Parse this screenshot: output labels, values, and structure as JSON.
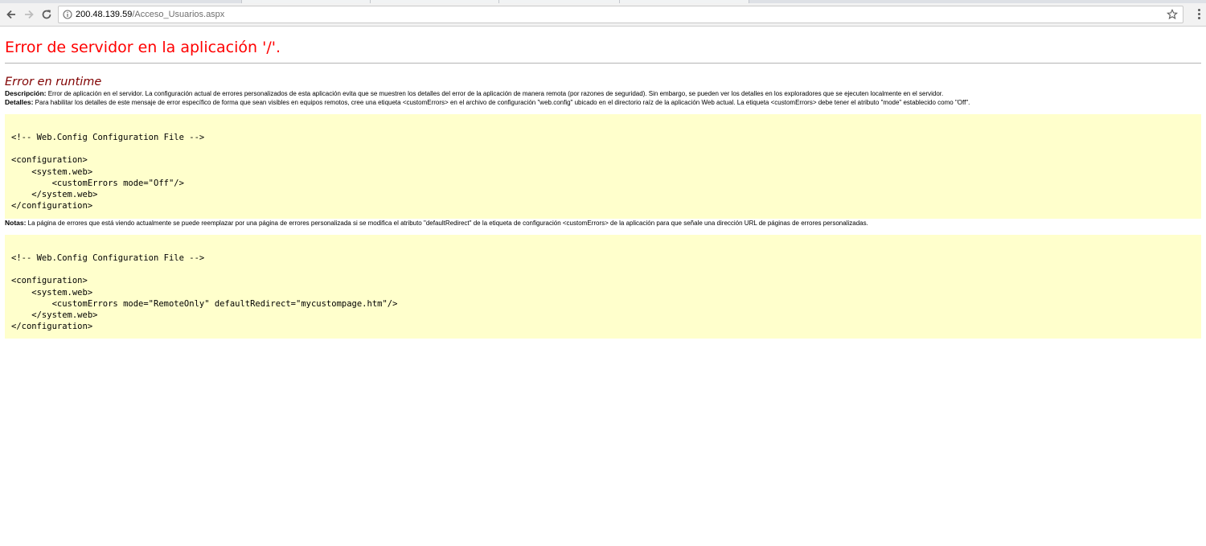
{
  "browser": {
    "url_host": "200.48.139.59",
    "url_path": "/Acceso_Usuarios.aspx",
    "icons": {
      "back": "back-arrow-icon",
      "forward": "forward-arrow-icon",
      "reload": "reload-icon",
      "info": "info-icon",
      "bookmark": "star-icon",
      "menu": "kebab-menu-icon"
    }
  },
  "page": {
    "title": "Error de servidor en la aplicación '/'.",
    "subtitle": "Error en runtime",
    "description_label": "Descripción:",
    "description_text": " Error de aplicación en el servidor. La configuración actual de errores personalizados de esta aplicación evita que se muestren los detalles del error de la aplicación de manera remota (por razones de seguridad). Sin embargo, se pueden ver los detalles en los exploradores que se ejecuten localmente en el servidor.",
    "details_label": "Detalles:",
    "details_text": " Para habilitar los detalles de este mensaje de error específico de forma que sean visibles en equipos remotos, cree una etiqueta <customErrors> en el archivo de configuración \"web.config\" ubicado en el directorio raíz de la aplicación Web actual. La etiqueta <customErrors> debe tener el atributo \"mode\" establecido como \"Off\".",
    "code1": "<!-- Web.Config Configuration File -->\n\n<configuration>\n    <system.web>\n        <customErrors mode=\"Off\"/>\n    </system.web>\n</configuration>",
    "notes_label": "Notas:",
    "notes_text": " La página de errores que está viendo actualmente se puede reemplazar por una página de errores personalizada si se modifica el atributo \"defaultRedirect\" de la etiqueta de configuración <customErrors> de la aplicación para que señale una dirección URL de páginas de errores personalizadas.",
    "code2": "<!-- Web.Config Configuration File -->\n\n<configuration>\n    <system.web>\n        <customErrors mode=\"RemoteOnly\" defaultRedirect=\"mycustompage.htm\"/>\n    </system.web>\n</configuration>"
  },
  "colors": {
    "title": "#ff0000",
    "subtitle": "#800000",
    "code_background": "#ffffcc"
  }
}
